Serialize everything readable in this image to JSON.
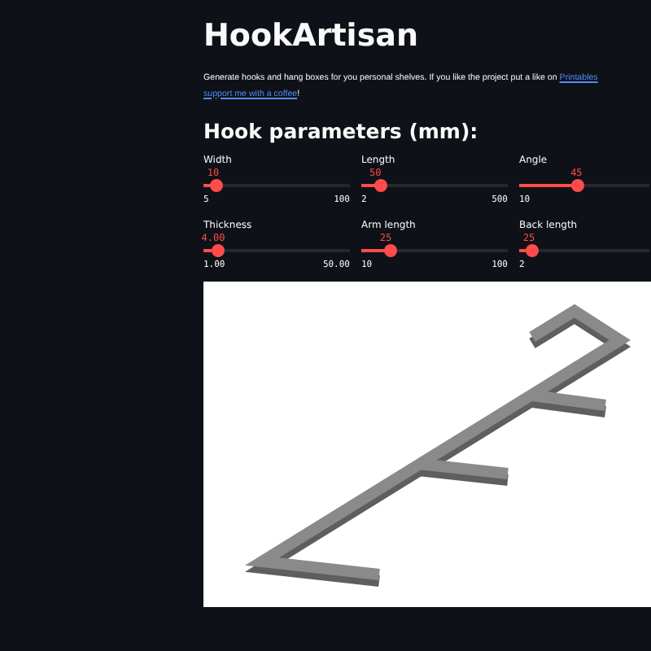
{
  "title": "HookArtisan",
  "description": {
    "text": "Generate hooks and hang boxes for you personal shelves. If you like the project put a like on ",
    "link": "Printables",
    "link2": "support me with a coffee",
    "end": "!"
  },
  "section_title": "Hook parameters (mm):",
  "sliders": [
    {
      "label": "Width",
      "value": "10",
      "min": "5",
      "max": "100",
      "level": 0.053
    },
    {
      "label": "Length",
      "value": "50",
      "min": "2",
      "max": "500",
      "level": 0.096
    },
    {
      "label": "Angle",
      "value": "45",
      "min": "10",
      "level": 0.44
    },
    {
      "label": "Thickness",
      "value": "4.00",
      "min": "1.00",
      "max": "50.00",
      "level": 0.061
    },
    {
      "label": "Arm length",
      "value": "25",
      "min": "10",
      "max": "100",
      "level": 0.167
    },
    {
      "label": "Back length",
      "value": "25",
      "min": "2",
      "level": 0.05
    }
  ],
  "viewer": {
    "kind": "model"
  }
}
